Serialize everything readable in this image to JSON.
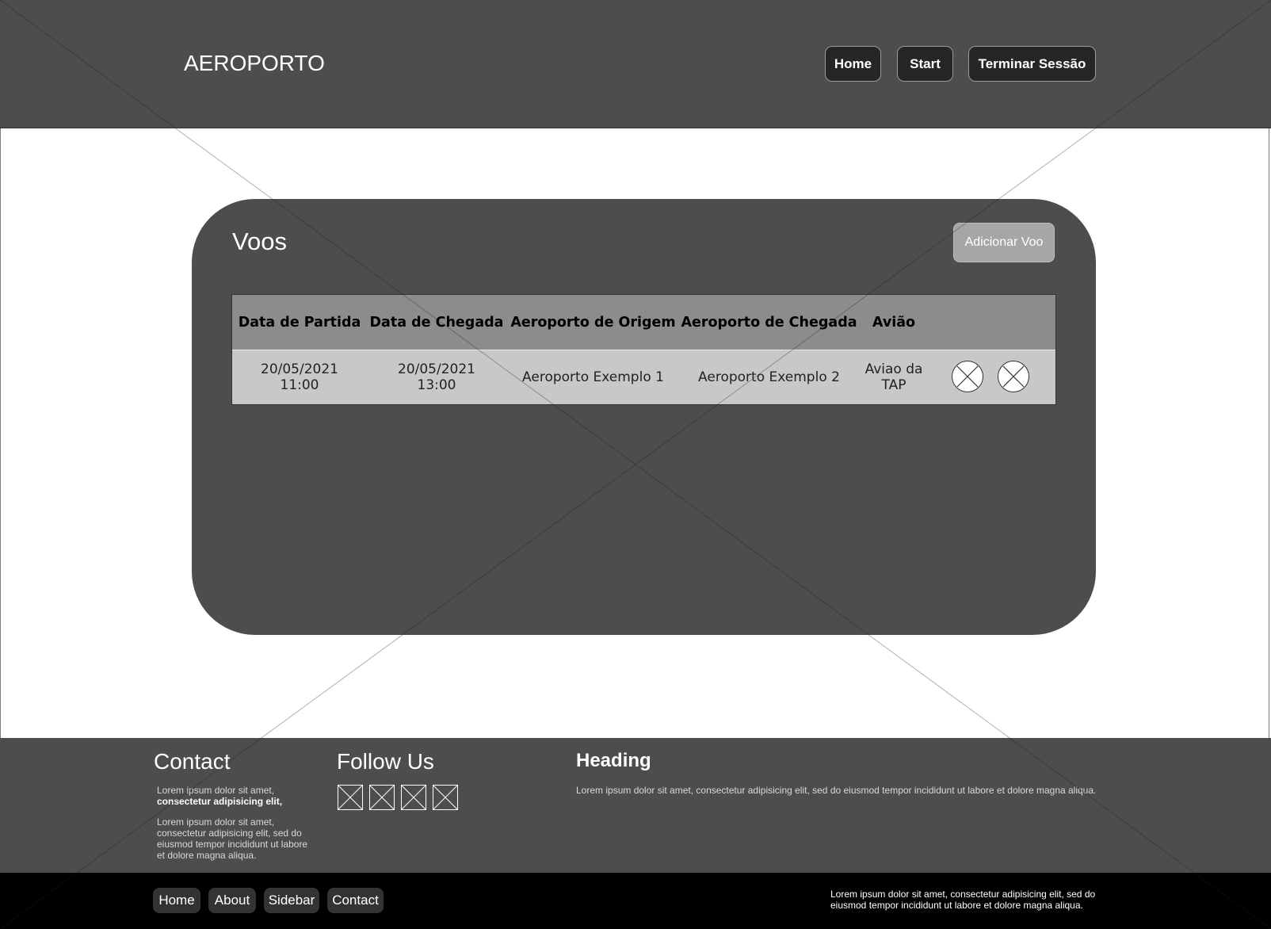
{
  "header": {
    "brand": "AEROPORTO",
    "nav": {
      "home": "Home",
      "start": "Start",
      "logout": "Terminar Sessão"
    }
  },
  "main": {
    "title": "Voos",
    "add_button": "Adicionar Voo",
    "table": {
      "columns": [
        "Data de Partida",
        "Data de Chegada",
        "Aeroporto de Origem",
        "Aeroporto de Chegada",
        "Avião"
      ],
      "rows": [
        {
          "departure": [
            "20/05/2021",
            "11:00"
          ],
          "arrival": [
            "20/05/2021",
            "13:00"
          ],
          "origin": "Aeroporto Exemplo 1",
          "destination": "Aeroporto Exemplo 2",
          "plane": [
            "Aviao da",
            "TAP"
          ]
        }
      ]
    }
  },
  "footer": {
    "contact": {
      "title": "Contact",
      "line1": "Lorem ipsum dolor sit amet,",
      "line1_bold": "consectetur adipisicing elit,",
      "para": [
        "Lorem ipsum dolor sit amet,",
        "consectetur adipisicing elit, sed do",
        "eiusmod tempor incididunt ut labore",
        "et dolore magna aliqua."
      ]
    },
    "follow": {
      "title": "Follow Us"
    },
    "heading": {
      "title": "Heading",
      "text": "Lorem ipsum dolor sit amet, consectetur adipisicing elit, sed do eiusmod tempor incididunt ut labore et dolore magna aliqua."
    },
    "bottom_nav": {
      "home": "Home",
      "about": "About",
      "sidebar": "Sidebar",
      "contact": "Contact"
    },
    "bottom_text": [
      "Lorem ipsum dolor sit amet, consectetur adipisicing elit, sed do",
      "eiusmod tempor incididunt ut labore et dolore magna aliqua."
    ]
  },
  "colors": {
    "dark": "#4d4d4d",
    "header_cell": "#8c8c8c",
    "row": "#c8c8c8",
    "button": "#262626"
  },
  "icons": {
    "delete": "circle-x-icon",
    "social": "image-placeholder-icon"
  }
}
